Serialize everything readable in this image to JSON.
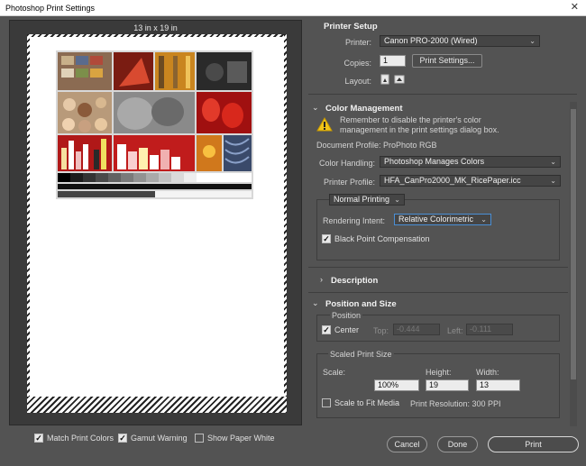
{
  "window": {
    "title": "Photoshop Print Settings",
    "close_glyph": "✕"
  },
  "preview": {
    "dimensions": "13 in x 19 in"
  },
  "bottom_options": {
    "match_print_colors": {
      "label": "Match Print Colors",
      "checked": true
    },
    "gamut_warning": {
      "label": "Gamut Warning",
      "checked": true
    },
    "show_paper_white": {
      "label": "Show Paper White",
      "checked": false
    }
  },
  "printer_setup": {
    "heading": "Printer Setup",
    "printer_label": "Printer:",
    "printer_value": "Canon PRO-2000 (Wired)",
    "copies_label": "Copies:",
    "copies_value": "1",
    "settings_button": "Print Settings...",
    "layout_label": "Layout:"
  },
  "color_management": {
    "heading": "Color Management",
    "warning": "Remember to disable the printer's color management in the print settings dialog box.",
    "doc_profile": "Document Profile: ProPhoto RGB",
    "handling_label": "Color Handling:",
    "handling_value": "Photoshop Manages Colors",
    "printer_profile_label": "Printer Profile:",
    "printer_profile_value": "HFA_CanPro2000_MK_RicePaper.icc",
    "mode_value": "Normal Printing",
    "intent_label": "Rendering Intent:",
    "intent_value": "Relative Colorimetric",
    "bpc": {
      "label": "Black Point Compensation",
      "checked": true
    }
  },
  "description": {
    "heading": "Description"
  },
  "position_size": {
    "heading": "Position and Size",
    "position_group": "Position",
    "center": {
      "label": "Center",
      "checked": true
    },
    "top_label": "Top:",
    "top_value": "-0.444",
    "left_label": "Left:",
    "left_value": "-0.111",
    "scaled_group": "Scaled Print Size",
    "scale_label": "Scale:",
    "scale_value": "100%",
    "height_label": "Height:",
    "height_value": "19",
    "width_label": "Width:",
    "width_value": "13",
    "fit_media": {
      "label": "Scale to Fit Media",
      "checked": false
    },
    "resolution": "Print Resolution: 300 PPI"
  },
  "actions": {
    "cancel": "Cancel",
    "done": "Done",
    "print": "Print"
  },
  "colors": {
    "background": "#535353",
    "panel_dark": "#3a3a3a",
    "accent_focus": "#4a8fd6",
    "warn_yellow": "#f0c419"
  }
}
